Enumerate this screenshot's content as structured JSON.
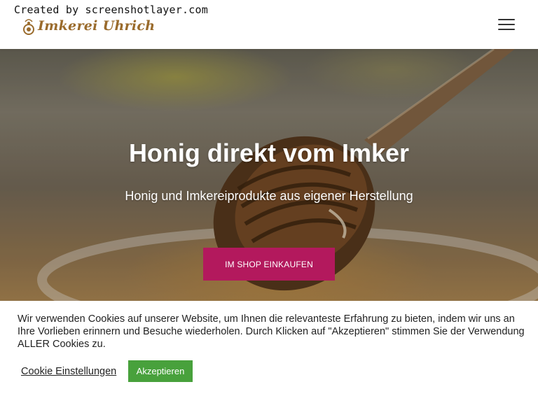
{
  "watermark": "Created by screenshotlayer.com",
  "header": {
    "logo_text": "Imkerei Uhrich",
    "logo_icon": "bee-icon",
    "menu_icon": "hamburger-menu-icon"
  },
  "hero": {
    "title": "Honig direkt vom Imker",
    "subtitle": "Honig und Imkereiprodukte aus eigener Herstellung",
    "cta_label": "IM SHOP EINKAUFEN"
  },
  "cookie_banner": {
    "text": "Wir verwenden Cookies auf unserer Website, um Ihnen die relevanteste Erfahrung zu bieten, indem wir uns an Ihre Vorlieben erinnern und Besuche wiederholen. Durch Klicken auf \"Akzeptieren\" stimmen Sie der Verwendung ALLER Cookies zu.",
    "settings_label": "Cookie Einstellungen",
    "accept_label": "Akzeptieren"
  },
  "colors": {
    "accent": "#b3195d",
    "accept": "#48a13c",
    "logo": "#9a6b2c"
  }
}
